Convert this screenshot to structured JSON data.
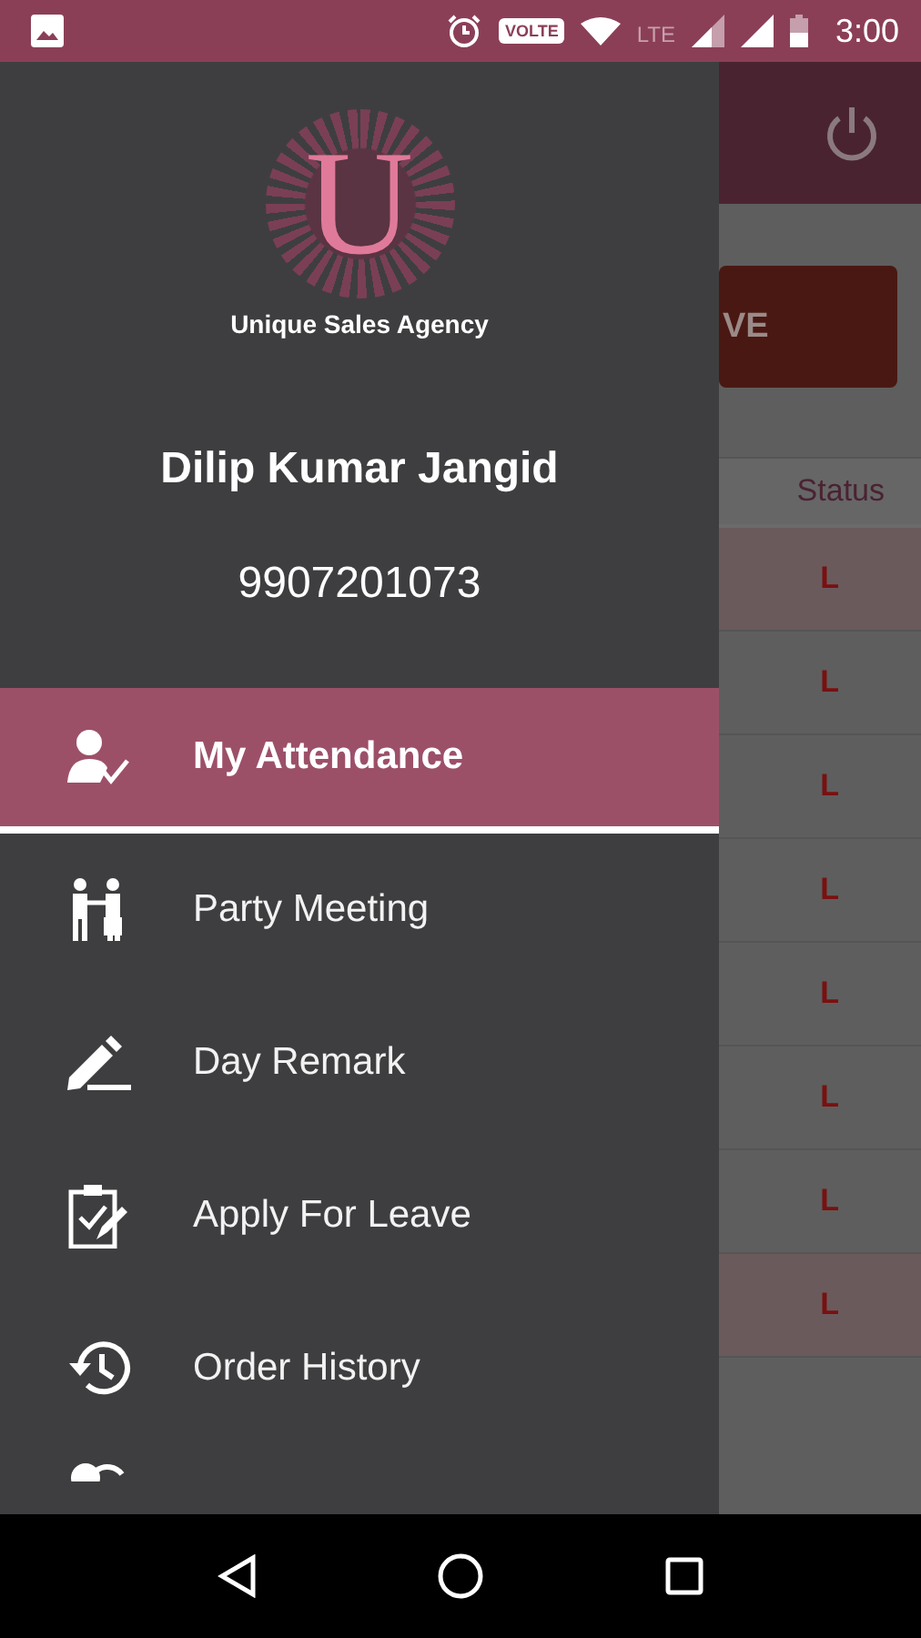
{
  "status_bar": {
    "volte": "VOLTE",
    "network": "LTE",
    "time": "3:00"
  },
  "background_screen": {
    "button_label": "VE",
    "status_header": "Status",
    "rows": [
      {
        "status": "L",
        "highlighted": true
      },
      {
        "status": "L",
        "highlighted": false
      },
      {
        "status": "L",
        "highlighted": false
      },
      {
        "status": "L",
        "highlighted": false
      },
      {
        "status": "L",
        "highlighted": false
      },
      {
        "status": "L",
        "highlighted": false
      },
      {
        "status": "L",
        "highlighted": false
      },
      {
        "status": "L",
        "highlighted": true
      }
    ]
  },
  "drawer": {
    "logo_letter": "U",
    "company": "Unique Sales Agency",
    "user_name": "Dilip Kumar Jangid",
    "phone": "9907201073",
    "items": [
      {
        "label": "My Attendance",
        "kind": "attendance",
        "selected": true
      },
      {
        "label": "Party Meeting",
        "kind": "meeting",
        "selected": false
      },
      {
        "label": "Day Remark",
        "kind": "remark",
        "selected": false
      },
      {
        "label": "Apply For Leave",
        "kind": "leave",
        "selected": false
      },
      {
        "label": "Order History",
        "kind": "history",
        "selected": false
      }
    ]
  }
}
